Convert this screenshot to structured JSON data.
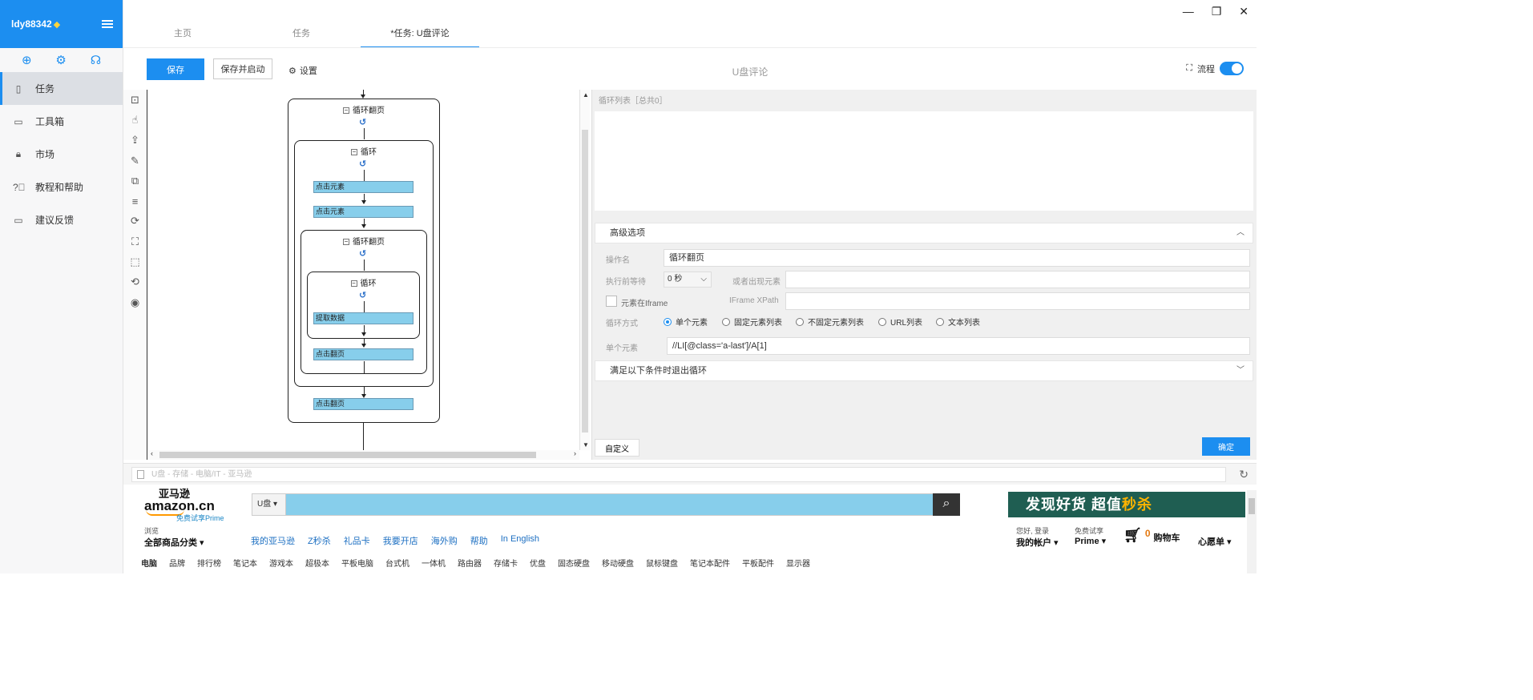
{
  "user": {
    "name": "ldy88342",
    "badge": "diamond-icon"
  },
  "sidebar": {
    "icons": [
      "add-circle-icon",
      "gear-icon",
      "headset-icon"
    ],
    "items": [
      {
        "label": "任务",
        "icon": "file-icon",
        "active": true
      },
      {
        "label": "工具箱",
        "icon": "toolbox-icon"
      },
      {
        "label": "市场",
        "icon": "lock-icon"
      },
      {
        "label": "教程和帮助",
        "icon": "help-circle-icon"
      },
      {
        "label": "建议反馈",
        "icon": "chat-icon"
      }
    ]
  },
  "tabs": [
    {
      "label": "主页"
    },
    {
      "label": "任务"
    },
    {
      "label": "*任务: U盘评论",
      "active": true
    }
  ],
  "toolbar": {
    "save": "保存",
    "save_start": "保存并启动",
    "settings": "设置",
    "task_title": "U盘评论",
    "flow_label": "流程",
    "flow_enabled": true
  },
  "tools": [
    "open-page-icon",
    "click-icon",
    "extract-icon",
    "input-icon",
    "switch-icon",
    "loop-icon",
    "condition-icon",
    "flow-icon",
    "mouse-move-icon",
    "wait-icon",
    "stop-icon"
  ],
  "flow": {
    "outer_loop": "循环翻页",
    "loop1": "循环",
    "click1": "点击元素",
    "click2": "点击元素",
    "inner_loop": "循环翻页",
    "loop2": "循环",
    "extract": "提取数据",
    "next1": "点击翻页",
    "next2": "点击翻页"
  },
  "panel": {
    "list_title": "循环列表［总共0］",
    "advanced": "高级选项",
    "op_name_label": "操作名",
    "op_name": "循环翻页",
    "wait_label": "执行前等待",
    "wait_value": "0 秒",
    "appear_label": "或者出现元素",
    "appear_value": "",
    "iframe_label": "元素在Iframe",
    "iframe_xpath_label": "IFrame XPath",
    "iframe_xpath": "",
    "loop_mode_label": "循环方式",
    "loop_modes": [
      "单个元素",
      "固定元素列表",
      "不固定元素列表",
      "URL列表",
      "文本列表"
    ],
    "loop_mode_selected": 0,
    "single_label": "单个元素",
    "single_value": "//LI[@class='a-last']/A[1]",
    "exit_cond": "满足以下条件时退出循环",
    "custom_btn": "自定义",
    "ok_btn": "确定"
  },
  "browser": {
    "address": "U盘 - 存储 - 电脑/IT - 亚马逊"
  },
  "amazon": {
    "logo_cn": "亚马逊",
    "logo_en": "amazon.cn",
    "prime_trial": "免费试享Prime",
    "search_dept": "U盘",
    "search_value": "",
    "banner": {
      "part1": "发现好货 超值",
      "part2": "秒杀"
    },
    "browse_small": "浏览",
    "browse_big": "全部商品分类",
    "links": [
      "我的亚马逊",
      "Z秒杀",
      "礼品卡",
      "我要开店",
      "海外购",
      "帮助",
      "In English"
    ],
    "account_small": "您好, 登录",
    "account_big": "我的帐户",
    "prime_small": "免费试享",
    "prime_big": "Prime",
    "cart_count": "0",
    "cart_label": "购物车",
    "wishlist": "心愿单",
    "categories": [
      "电脑",
      "品牌",
      "排行榜",
      "笔记本",
      "游戏本",
      "超极本",
      "平板电脑",
      "台式机",
      "一体机",
      "路由器",
      "存储卡",
      "优盘",
      "固态硬盘",
      "移动硬盘",
      "鼠标键盘",
      "笔记本配件",
      "平板配件",
      "显示器"
    ]
  }
}
